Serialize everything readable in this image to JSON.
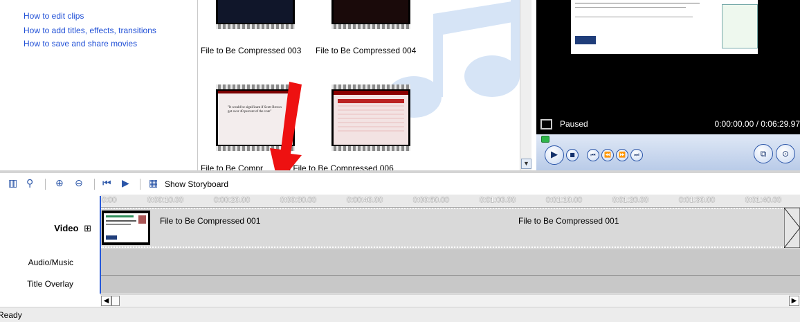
{
  "task_pane": {
    "links": [
      "How to edit clips",
      "How to add titles, effects, transitions",
      "How to save and share movies"
    ]
  },
  "collection": {
    "clips": [
      {
        "label": "File to Be Compressed 003"
      },
      {
        "label": "File to Be Compressed 004"
      },
      {
        "label": "File to Be Compressed 005",
        "visible_label": "File to Be Compr"
      },
      {
        "label": "File to Be Compressed 006",
        "visible_label": "005  File to Be Compressed 006"
      }
    ],
    "thumb_quote": "\"It would be significant if Scott Brown got over 40 percent of the vote\""
  },
  "monitor": {
    "status": "Paused",
    "time": "0:00:00.00 / 0:06:29.97"
  },
  "timeline": {
    "show_storyboard_label": "Show Storyboard",
    "ruler_ticks": [
      "0:00",
      "0:00:10.00",
      "0:00:20.00",
      "0:00:30.00",
      "0:00:40.00",
      "0:00:50.00",
      "0:01:00.00",
      "0:01:10.00",
      "0:01:20.00",
      "0:01:30.00",
      "0:01:40.00"
    ],
    "tracks": {
      "video": "Video",
      "audio": "Audio/Music",
      "title": "Title Overlay"
    },
    "expand_symbol": "⊞",
    "clip_labels": [
      "File to Be Compressed 001",
      "File to Be Compressed 001"
    ]
  },
  "status_bar": {
    "text": "Ready"
  },
  "colors": {
    "link": "#1f4fd6",
    "arrow": "#ee1111",
    "playhead": "#2558d9"
  },
  "icons": [
    "storyboard-timeline-icon",
    "narrate-icon",
    "zoom-in-icon",
    "zoom-out-icon",
    "rewind-icon",
    "play-icon",
    "film-strip-icon",
    "play-button",
    "stop-button",
    "previous-frame",
    "next-frame",
    "split-icon",
    "snapshot-icon"
  ]
}
